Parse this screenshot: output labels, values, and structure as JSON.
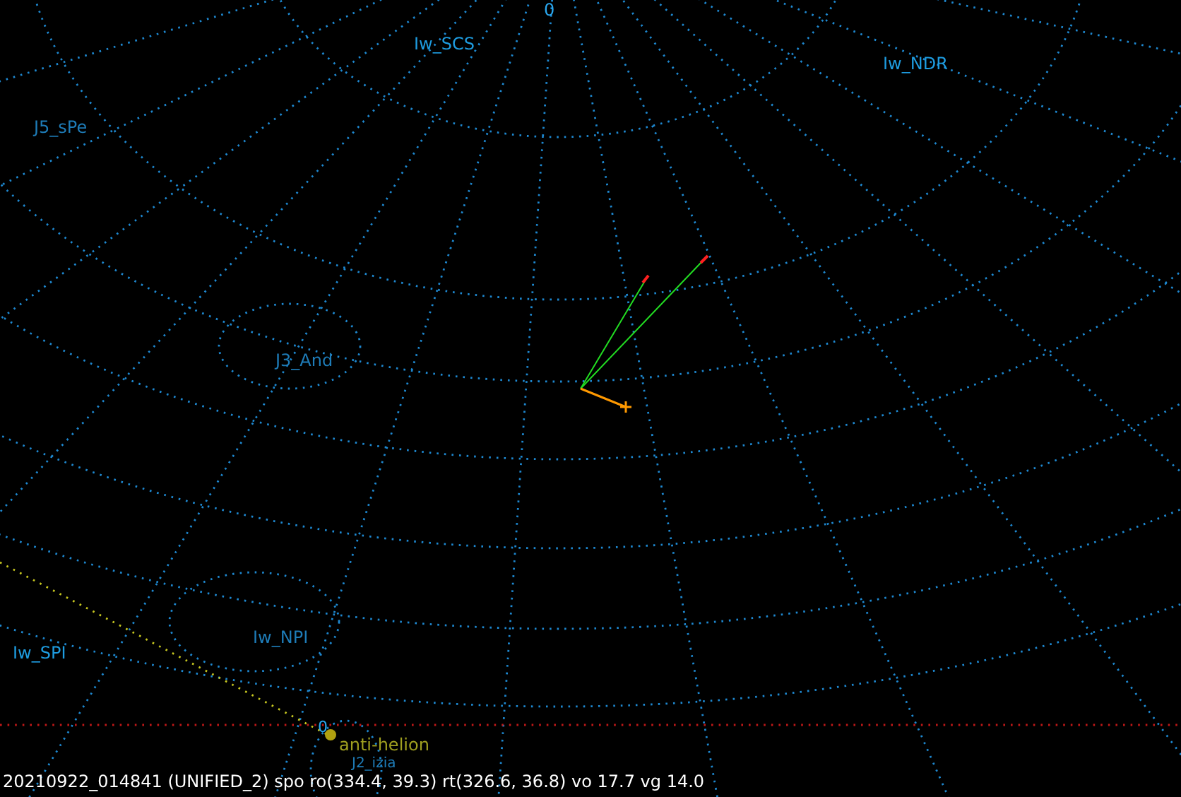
{
  "sky_chart": {
    "labels": [
      {
        "kind": "zenith",
        "text": "0"
      },
      {
        "kind": "radiant",
        "text": "Iw_SCS"
      },
      {
        "kind": "radiant",
        "text": "Iw_NDR"
      },
      {
        "kind": "radiant",
        "text": "J5_sPe"
      },
      {
        "kind": "radiant",
        "text": "J3_And"
      },
      {
        "kind": "radiant",
        "text": "Iw_NPI"
      },
      {
        "kind": "radiant",
        "text": "Iw_SPI"
      },
      {
        "kind": "zenith",
        "text": "0"
      },
      {
        "kind": "helion",
        "text": "anti-helion"
      },
      {
        "kind": "radiant",
        "text": "J2_izia"
      }
    ]
  },
  "status_bar": {
    "text": "20210922_014841 (UNIFIED_2) spo ro(334.4, 39.3) rt(326.6, 36.8) vo 17.7 vg 14.0"
  }
}
